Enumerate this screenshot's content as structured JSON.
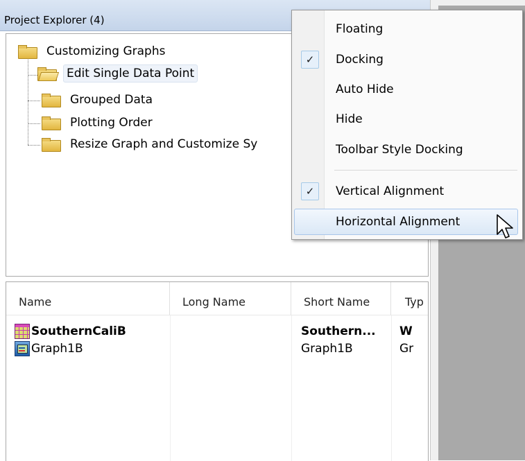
{
  "panel": {
    "title": "Project Explorer (4)"
  },
  "tree": {
    "root": "Customizing Graphs",
    "children": [
      "Edit Single Data Point",
      "Grouped Data",
      "Plotting Order",
      "Resize Graph and Customize Sy"
    ],
    "selected": "Edit Single Data Point"
  },
  "list": {
    "columns": [
      "Name",
      "Long Name",
      "Short Name",
      "Typ"
    ],
    "rows": [
      {
        "icon": "workbook-icon",
        "name": "SouthernCaliB",
        "long_name": "",
        "short_name": "Southern...",
        "type": "W",
        "bold": true
      },
      {
        "icon": "graph-icon",
        "name": "Graph1B",
        "long_name": "",
        "short_name": "Graph1B",
        "type": "Gr",
        "bold": false
      }
    ]
  },
  "menu": {
    "items": [
      {
        "label": "Floating",
        "checked": false
      },
      {
        "label": "Docking",
        "checked": true
      },
      {
        "label": "Auto Hide",
        "checked": false
      },
      {
        "label": "Hide",
        "checked": false
      },
      {
        "label": "Toolbar Style Docking",
        "checked": false
      },
      {
        "label": "Vertical Alignment",
        "checked": true
      },
      {
        "label": "Horizontal Alignment",
        "checked": false,
        "hovered": true
      }
    ],
    "check_glyph": "✓"
  }
}
